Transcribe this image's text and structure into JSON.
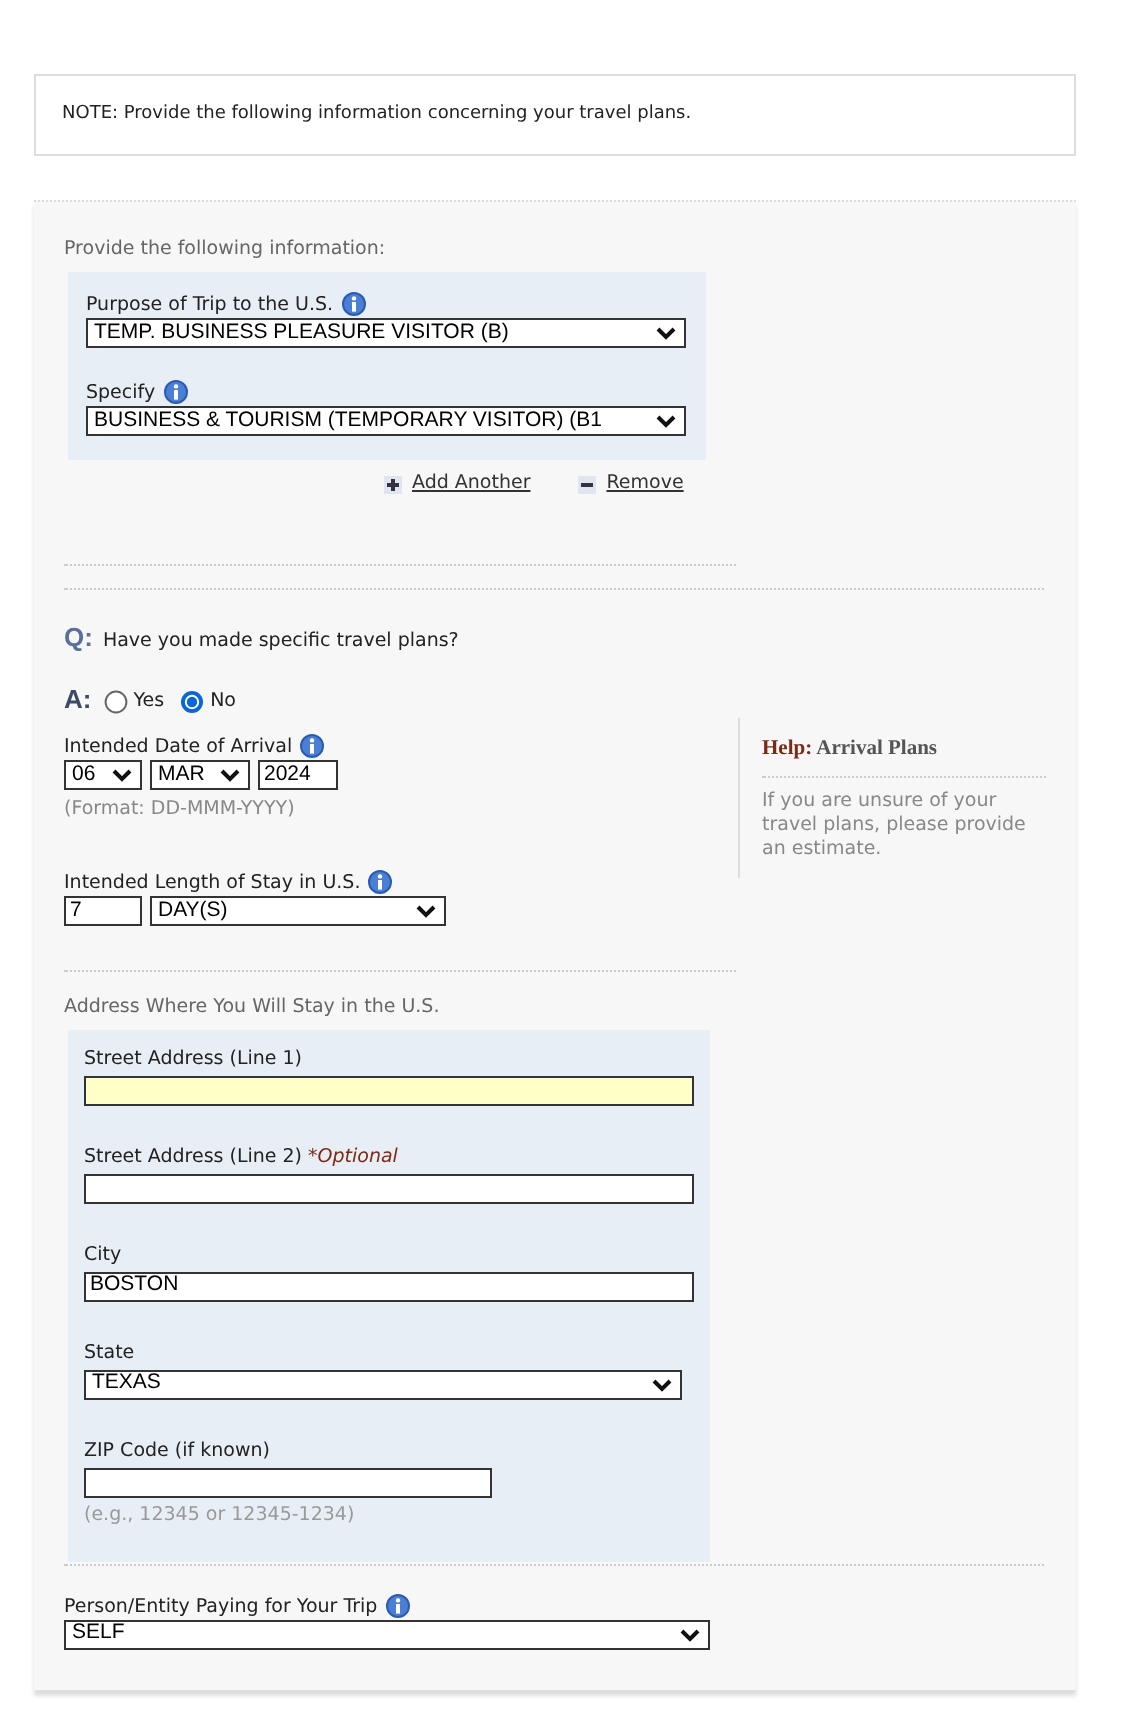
{
  "note": "NOTE: Provide the following information concerning your travel plans.",
  "section_label": "Provide the following information:",
  "purpose_fields": [
    {
      "label": "Purpose of Trip to the U.S.",
      "value": "TEMP. BUSINESS PLEASURE VISITOR (B)"
    },
    {
      "label": "Specify",
      "value": "BUSINESS & TOURISM (TEMPORARY VISITOR) (B1"
    }
  ],
  "add_link": "Add Another",
  "remove_link": "Remove",
  "question": {
    "prefix": "Q:",
    "text": "Have you made specific travel plans?"
  },
  "answer": {
    "prefix": "A:",
    "options": [
      {
        "label": "Yes",
        "selected": false
      },
      {
        "label": "No",
        "selected": true
      }
    ]
  },
  "arrival": {
    "label": "Intended Date of Arrival",
    "day": "06",
    "month": "MAR",
    "year": "2024",
    "format": "(Format: DD-MMM-YYYY)"
  },
  "stay": {
    "label": "Intended Length of Stay in U.S.",
    "value": "7",
    "unit": "DAY(S)"
  },
  "help": {
    "prefix": "Help:",
    "title": "Arrival Plans",
    "text": "If you are unsure of your travel plans, please provide an estimate."
  },
  "address": {
    "heading": "Address Where You Will Stay in the U.S.",
    "fields": [
      {
        "kind": "text",
        "label": "Street Address (Line 1)",
        "highlighted": true
      },
      {
        "kind": "text",
        "label": "Street Address (Line 2)",
        "note": "*Optional",
        "highlighted": false
      },
      {
        "kind": "text",
        "label": "City",
        "value": "BOSTON",
        "highlighted": false
      },
      {
        "kind": "select",
        "label": "State",
        "value": "TEXAS"
      },
      {
        "kind": "zip",
        "label": "ZIP Code (if known)",
        "hint": "(e.g., 12345 or 12345-1234)",
        "highlighted": false
      }
    ]
  },
  "payer": {
    "label": "Person/Entity Paying for Your Trip",
    "value": "SELF"
  }
}
